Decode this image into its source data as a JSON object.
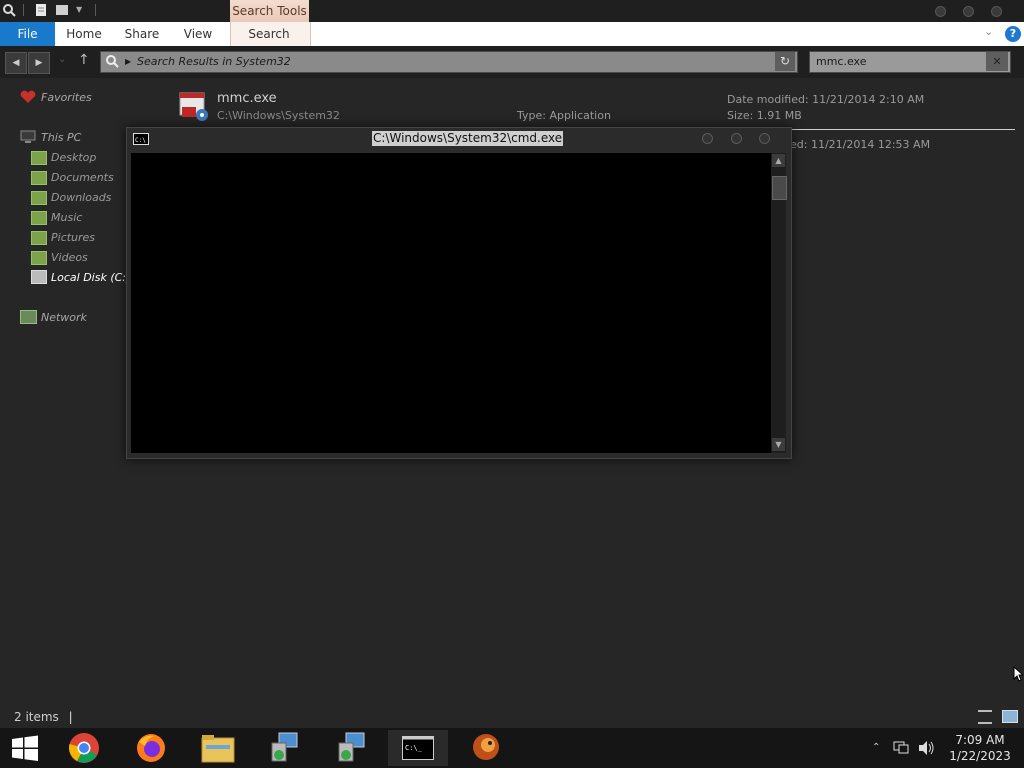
{
  "ribbon": {
    "context_tab": "Search Tools",
    "tabs": [
      "File",
      "Home",
      "Share",
      "View",
      "Search"
    ],
    "help": "?"
  },
  "address": {
    "path": "Search Results in System32",
    "search_value": "mmc.exe"
  },
  "sidebar": {
    "favorites": "Favorites",
    "this_pc": "This PC",
    "items": [
      "Desktop",
      "Documents",
      "Downloads",
      "Music",
      "Pictures",
      "Videos",
      "Local Disk (C:)"
    ],
    "network": "Network"
  },
  "results": {
    "file1": {
      "name": "mmc.exe",
      "path": "C:\\Windows\\System32",
      "type": "Type: Application",
      "modified": "Date modified: 11/21/2014 2:10 AM",
      "size": "Size: 1.91 MB"
    },
    "file2": {
      "modified_partial": "ed: 11/21/2014 12:53 AM"
    }
  },
  "cmd": {
    "title": "C:\\Windows\\System32\\cmd.exe"
  },
  "status": {
    "items": "2 items"
  },
  "taskbar": {
    "time": "7:09 AM",
    "date": "1/22/2023",
    "apps": [
      "start-icon",
      "chrome-icon",
      "firefox-icon",
      "file-explorer-icon",
      "network-setup-icon",
      "network-setup-icon",
      "cmd-icon",
      "app-icon"
    ]
  },
  "colors": {
    "accent": "#1979ca",
    "context_tab": "#e9c8b8",
    "background": "#262626"
  }
}
